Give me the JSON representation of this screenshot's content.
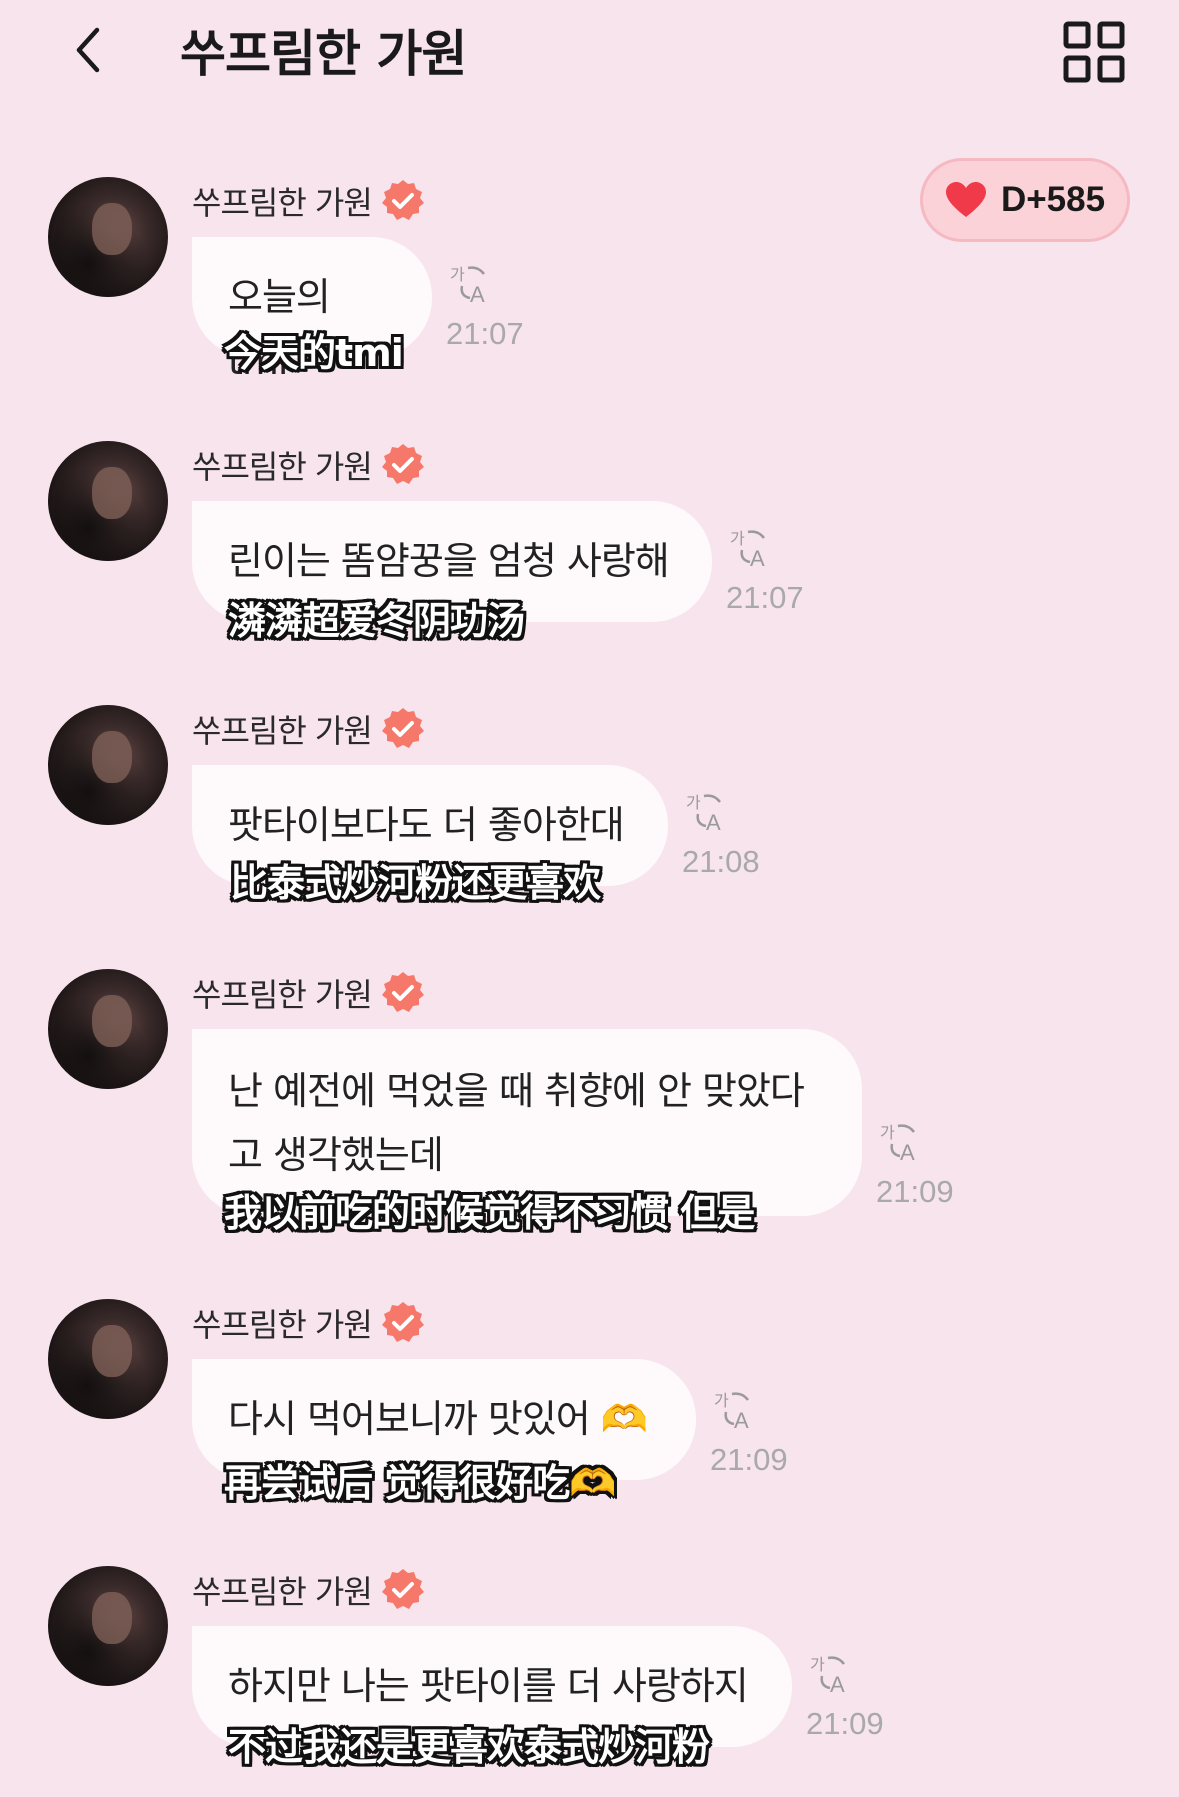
{
  "header": {
    "title": "쑤프림한 가원",
    "back_icon": "chevron-left-icon",
    "menu_icon": "grid-menu-icon"
  },
  "dday_badge": {
    "text": "D+585",
    "icon": "heart-icon",
    "heart_color": "#f03a4a"
  },
  "colors": {
    "background": "#f8e4ed",
    "bubble": "#fefafb",
    "verified_badge": "#f6786a",
    "timestamp": "#a9a9a9"
  },
  "messages": [
    {
      "sender": "쑤프림한 가원",
      "text": "오늘의 tmi",
      "subtitle": "今天的tmi",
      "time": "21:07"
    },
    {
      "sender": "쑤프림한 가원",
      "text": "린이는 똠얌꿍을 엄청 사랑해",
      "subtitle": "潾潾超爱冬阴功汤",
      "time": "21:07"
    },
    {
      "sender": "쑤프림한 가원",
      "text": "팟타이보다도 더 좋아한대",
      "subtitle": "比泰式炒河粉还更喜欢",
      "time": "21:08"
    },
    {
      "sender": "쑤프림한 가원",
      "text": "난 예전에 먹었을 때 취향에 안 맞았다\n고 생각했는데",
      "subtitle": "我以前吃的时候觉得不习惯 但是",
      "time": "21:09"
    },
    {
      "sender": "쑤프림한 가원",
      "text": "다시 먹어보니까 맛있어 🫶",
      "subtitle": "再尝试后 觉得很好吃🫶",
      "time": "21:09"
    },
    {
      "sender": "쑤프림한 가원",
      "text": "하지만 나는 팟타이를 더 사랑하지",
      "subtitle": "不过我还是更喜欢泰式炒河粉",
      "time": "21:09"
    }
  ]
}
